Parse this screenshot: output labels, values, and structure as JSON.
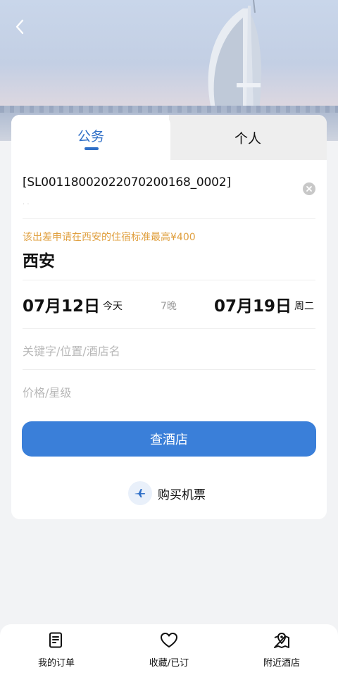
{
  "colors": {
    "accent": "#2f6fc7",
    "button": "#3a7fd9",
    "warning_text": "#e0a040",
    "placeholder": "#b8b8b8"
  },
  "header": {
    "back_icon": "chevron-left-icon"
  },
  "tabs": [
    {
      "label": "公务",
      "active": true
    },
    {
      "label": "个人",
      "active": false
    }
  ],
  "approval": {
    "code": "[SL0011800202207020​0168_0002]",
    "clear_icon": "close-circle-icon"
  },
  "standard_notice": "该出差申请在西安的住宿标准最高¥400",
  "city": "西安",
  "dates": {
    "checkin": "07月12日",
    "checkin_day": "今天",
    "nights": "7晚",
    "checkout": "07月19日",
    "checkout_day": "周二"
  },
  "keyword_placeholder": "关键字/位置/酒店名",
  "price_placeholder": "价格/星级",
  "search_button": "查酒店",
  "flight_link": {
    "label": "购买机票",
    "icon": "airplane-icon"
  },
  "bottom_nav": [
    {
      "label": "我的订单",
      "icon": "order-list-icon"
    },
    {
      "label": "收藏/已订",
      "icon": "heart-icon"
    },
    {
      "label": "附近酒店",
      "icon": "map-pin-icon"
    }
  ]
}
